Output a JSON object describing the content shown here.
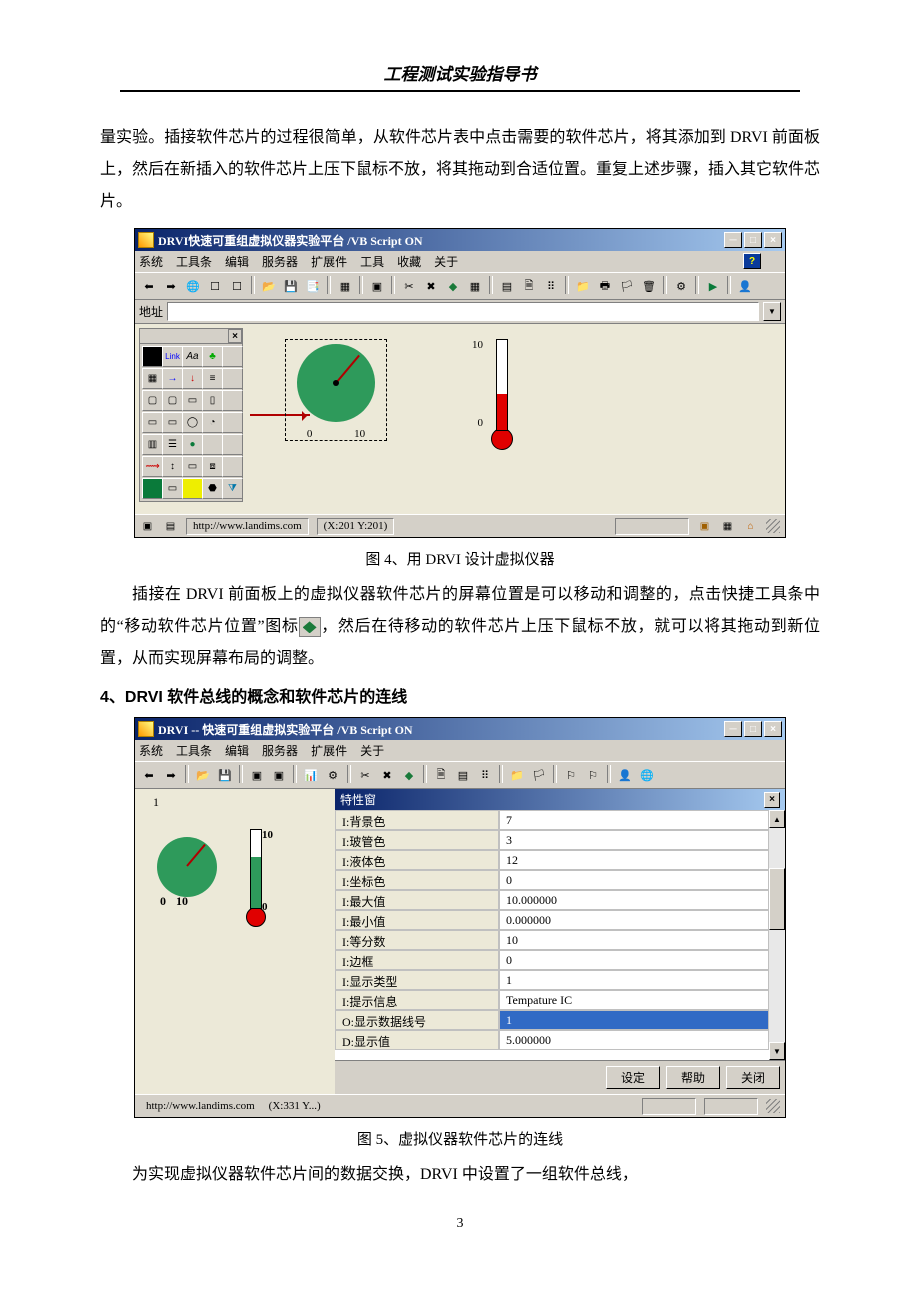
{
  "doc": {
    "header": "工程测试实验指导书",
    "para1": "量实验。插接软件芯片的过程很简单，从软件芯片表中点击需要的软件芯片，将其添加到 DRVI 前面板上，然后在新插入的软件芯片上压下鼠标不放，将其拖动到合适位置。重复上述步骤，插入其它软件芯片。",
    "fig4cap": "图 4、用 DRVI 设计虚拟仪器",
    "para2a": "插接在 DRVI 前面板上的虚拟仪器软件芯片的屏幕位置是可以移动和调整的，点击快捷工具条中的“移动软件芯片位置”图标",
    "para2b": "，然后在待移动的软件芯片上压下鼠标不放，就可以将其拖动到新位置，从而实现屏幕布局的调整。",
    "section4": "4、DRVI 软件总线的概念和软件芯片的连线",
    "fig5cap": "图 5、虚拟仪器软件芯片的连线",
    "para3": "为实现虚拟仪器软件芯片间的数据交换，DRVI 中设置了一组软件总线，",
    "pagenum": "3"
  },
  "fig4": {
    "title": "DRVI快速可重组虚拟仪器实验平台 /VB Script ON",
    "menus": [
      "系统",
      "工具条",
      "编辑",
      "服务器",
      "扩展件",
      "工具",
      "收藏",
      "关于"
    ],
    "addr_label": "地址",
    "addr_value": "",
    "gauge_min": "0",
    "gauge_max": "10",
    "thermo_max": "10",
    "thermo_min": "0",
    "status_url": "http://www.landims.com",
    "status_coord": "(X:201 Y:201)"
  },
  "fig5": {
    "title": "DRVI -- 快速可重组虚拟实验平台  /VB Script ON",
    "menus": [
      "系统",
      "工具条",
      "编辑",
      "服务器",
      "扩展件",
      "关于"
    ],
    "props_title": "特性窗",
    "left_num": "1",
    "gauge_min": "0",
    "gauge_max": "10",
    "thermo_max": "10",
    "thermo_min": "0",
    "rows": [
      {
        "k": "I:背景色",
        "v": "7"
      },
      {
        "k": "I:玻管色",
        "v": "3"
      },
      {
        "k": "I:液体色",
        "v": "12"
      },
      {
        "k": "I:坐标色",
        "v": "0"
      },
      {
        "k": "I:最大值",
        "v": "10.000000"
      },
      {
        "k": "I:最小值",
        "v": "0.000000"
      },
      {
        "k": "I:等分数",
        "v": "10"
      },
      {
        "k": "I:边框",
        "v": "0"
      },
      {
        "k": "I:显示类型",
        "v": "1"
      },
      {
        "k": "I:提示信息",
        "v": "Tempature IC"
      },
      {
        "k": "O:显示数据线号",
        "v": "1",
        "sel": true
      },
      {
        "k": "D:显示值",
        "v": "5.000000"
      }
    ],
    "btn_set": "设定",
    "btn_help": "帮助",
    "btn_close": "关闭",
    "status_url": "http://www.landims.com",
    "status_coord": "(X:331 Y...)"
  }
}
